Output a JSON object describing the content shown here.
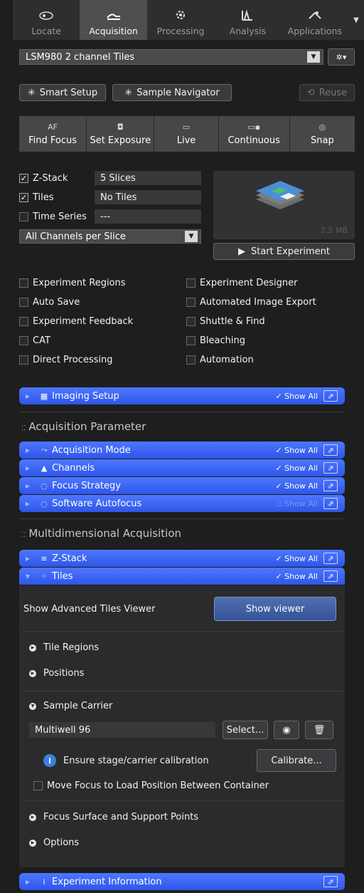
{
  "tabs": [
    {
      "label": "Locate",
      "icon": "eye-icon",
      "active": false
    },
    {
      "label": "Acquisition",
      "icon": "acquisition-icon",
      "active": true
    },
    {
      "label": "Processing",
      "icon": "gear-icon",
      "active": false
    },
    {
      "label": "Analysis",
      "icon": "analysis-icon",
      "active": false
    },
    {
      "label": "Applications",
      "icon": "applications-icon",
      "active": false
    }
  ],
  "experiment": {
    "name": "LSM980 2 channel Tiles"
  },
  "setup": {
    "smart": "Smart Setup",
    "navigator": "Sample Navigator",
    "reuse": "Reuse"
  },
  "camera": [
    {
      "icon": "AF",
      "label": "Find Focus"
    },
    {
      "icon": "◘",
      "label": "Set Exposure"
    },
    {
      "icon": "▭",
      "label": "Live"
    },
    {
      "icon": "▭▪",
      "label": "Continuous"
    },
    {
      "icon": "◎",
      "label": "Snap"
    }
  ],
  "dims": {
    "zstack": {
      "label": "Z-Stack",
      "value": "5 Slices",
      "checked": "✓"
    },
    "tiles": {
      "label": "Tiles",
      "value": "No Tiles",
      "checked": "✓"
    },
    "time": {
      "label": "Time Series",
      "value": "---",
      "checked": ""
    }
  },
  "channels_mode": "All Channels per Slice",
  "preview_size": "2.5 MB",
  "start_label": "Start Experiment",
  "options_left": [
    "Experiment Regions",
    "Auto Save",
    "Experiment Feedback",
    "CAT",
    "Direct Processing"
  ],
  "options_right": [
    "Experiment Designer",
    "Automated Image Export",
    "Shuttle & Find",
    "Bleaching",
    "Automation"
  ],
  "show_all": "Show All",
  "bars": {
    "imaging": "Imaging Setup",
    "acq_mode": "Acquisition Mode",
    "channels": "Channels",
    "focus": "Focus Strategy",
    "autofocus": "Software Autofocus",
    "zstack": "Z-Stack",
    "tiles": "Tiles",
    "info": "Experiment Information"
  },
  "sections": {
    "acq": "Acquisition Parameter",
    "multi": "Multidimensional Acquisition"
  },
  "tiles_panel": {
    "viewer_label": "Show Advanced Tiles Viewer",
    "viewer_btn": "Show viewer",
    "tile_regions": "Tile Regions",
    "positions": "Positions",
    "sample_carrier": "Sample Carrier",
    "carrier_value": "Multiwell 96",
    "select_btn": "Select...",
    "calib_text": "Ensure stage/carrier calibration",
    "calibrate_btn": "Calibrate...",
    "move_focus": "Move Focus to Load Position Between Container",
    "focus_surface": "Focus Surface and Support Points",
    "options": "Options"
  },
  "colors": {
    "accent": "#3a63f0",
    "bg": "#1e1e1f"
  }
}
